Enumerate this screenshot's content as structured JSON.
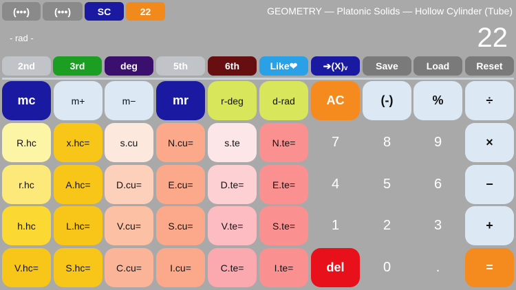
{
  "top_tabs": [
    {
      "label": "(•••)",
      "bg": "#8a8a8a"
    },
    {
      "label": "(•••)",
      "bg": "#8a8a8a"
    },
    {
      "label": "SC",
      "bg": "#1a19a2"
    },
    {
      "label": "22",
      "bg": "#f28a1b"
    }
  ],
  "header": {
    "title": "GEOMETRY — Platonic Solids — Hollow Cylinder (Tube)",
    "angle_mode": "- rad -",
    "display_value": "22"
  },
  "function_row": [
    {
      "label": "2nd",
      "bg": "#c0c3c7",
      "fg": "#ffffff"
    },
    {
      "label": "3rd",
      "bg": "#1b9e22",
      "fg": "#ffffff"
    },
    {
      "label": "deg",
      "bg": "#3a0f6e",
      "fg": "#ffffff"
    },
    {
      "label": "5th",
      "bg": "#c0c3c7",
      "fg": "#ffffff"
    },
    {
      "label": "6th",
      "bg": "#660e10",
      "fg": "#ffffff"
    },
    {
      "label": "Like❤",
      "bg": "#2aa0e6",
      "fg": "#ffffff"
    },
    {
      "label": "➔(X)ᵥ",
      "bg": "#1a19a2",
      "fg": "#ffffff"
    },
    {
      "label": "Save",
      "bg": "#7a7a7a",
      "fg": "#ffffff"
    },
    {
      "label": "Load",
      "bg": "#7a7a7a",
      "fg": "#ffffff"
    },
    {
      "label": "Reset",
      "bg": "#7a7a7a",
      "fg": "#ffffff"
    }
  ],
  "keypad": [
    [
      {
        "label": "mc",
        "bg": "#1a19a2",
        "fg": "#ffffff",
        "style": "big"
      },
      {
        "label": "m+",
        "bg": "#dce9f5",
        "fg": "#111111",
        "style": "mid"
      },
      {
        "label": "m−",
        "bg": "#dce9f5",
        "fg": "#111111",
        "style": "mid"
      },
      {
        "label": "mr",
        "bg": "#1a19a2",
        "fg": "#ffffff",
        "style": "big"
      },
      {
        "label": "r-deg",
        "bg": "#d7e65a",
        "fg": "#111111",
        "style": "mid"
      },
      {
        "label": "d-rad",
        "bg": "#d7e65a",
        "fg": "#111111",
        "style": "mid"
      },
      {
        "label": "AC",
        "bg": "#f58a1f",
        "fg": "#ffffff",
        "style": "big"
      },
      {
        "label": "(-)",
        "bg": "#dce9f5",
        "fg": "#111111",
        "style": "big"
      },
      {
        "label": "%",
        "bg": "#dce9f5",
        "fg": "#111111",
        "style": "big"
      },
      {
        "label": "÷",
        "bg": "#dce9f5",
        "fg": "#111111",
        "style": "big"
      }
    ],
    [
      {
        "label": "R.hc",
        "bg": "#fdf5a6",
        "fg": "#111111",
        "style": "mid"
      },
      {
        "label": "x.hc=",
        "bg": "#f8c618",
        "fg": "#111111",
        "style": "mid"
      },
      {
        "label": "s.cu",
        "bg": "#fde8de",
        "fg": "#111111",
        "style": "mid"
      },
      {
        "label": "N.cu=",
        "bg": "#fba98a",
        "fg": "#111111",
        "style": "mid"
      },
      {
        "label": "s.te",
        "bg": "#fde6e8",
        "fg": "#111111",
        "style": "mid"
      },
      {
        "label": "N.te=",
        "bg": "#fa9090",
        "fg": "#111111",
        "style": "mid"
      },
      {
        "label": "7",
        "bg": "",
        "fg": "#ffffff",
        "style": "digit"
      },
      {
        "label": "8",
        "bg": "",
        "fg": "#ffffff",
        "style": "digit"
      },
      {
        "label": "9",
        "bg": "",
        "fg": "#ffffff",
        "style": "digit"
      },
      {
        "label": "×",
        "bg": "#dce9f5",
        "fg": "#111111",
        "style": "big"
      }
    ],
    [
      {
        "label": "r.hc",
        "bg": "#fde97a",
        "fg": "#111111",
        "style": "mid"
      },
      {
        "label": "A.hc=",
        "bg": "#f8c618",
        "fg": "#111111",
        "style": "mid"
      },
      {
        "label": "D.cu=",
        "bg": "#fdd0bb",
        "fg": "#111111",
        "style": "mid"
      },
      {
        "label": "E.cu=",
        "bg": "#fba98a",
        "fg": "#111111",
        "style": "mid"
      },
      {
        "label": "D.te=",
        "bg": "#fdd0d4",
        "fg": "#111111",
        "style": "mid"
      },
      {
        "label": "E.te=",
        "bg": "#fa9090",
        "fg": "#111111",
        "style": "mid"
      },
      {
        "label": "4",
        "bg": "",
        "fg": "#ffffff",
        "style": "digit"
      },
      {
        "label": "5",
        "bg": "",
        "fg": "#ffffff",
        "style": "digit"
      },
      {
        "label": "6",
        "bg": "",
        "fg": "#ffffff",
        "style": "digit"
      },
      {
        "label": "−",
        "bg": "#dce9f5",
        "fg": "#111111",
        "style": "big"
      }
    ],
    [
      {
        "label": "h.hc",
        "bg": "#fcd833",
        "fg": "#111111",
        "style": "mid"
      },
      {
        "label": "L.hc=",
        "bg": "#f8c618",
        "fg": "#111111",
        "style": "mid"
      },
      {
        "label": "V.cu=",
        "bg": "#fcc0a4",
        "fg": "#111111",
        "style": "mid"
      },
      {
        "label": "S.cu=",
        "bg": "#fba98a",
        "fg": "#111111",
        "style": "mid"
      },
      {
        "label": "V.te=",
        "bg": "#fcbcc2",
        "fg": "#111111",
        "style": "mid"
      },
      {
        "label": "S.te=",
        "bg": "#fa9090",
        "fg": "#111111",
        "style": "mid"
      },
      {
        "label": "1",
        "bg": "",
        "fg": "#ffffff",
        "style": "digit"
      },
      {
        "label": "2",
        "bg": "",
        "fg": "#ffffff",
        "style": "digit"
      },
      {
        "label": "3",
        "bg": "",
        "fg": "#ffffff",
        "style": "digit"
      },
      {
        "label": "+",
        "bg": "#dce9f5",
        "fg": "#111111",
        "style": "big"
      }
    ],
    [
      {
        "label": "V.hc=",
        "bg": "#f8c618",
        "fg": "#111111",
        "style": "mid"
      },
      {
        "label": "S.hc=",
        "bg": "#f8c618",
        "fg": "#111111",
        "style": "mid"
      },
      {
        "label": "C.cu=",
        "bg": "#fbb497",
        "fg": "#111111",
        "style": "mid"
      },
      {
        "label": "I.cu=",
        "bg": "#fba98a",
        "fg": "#111111",
        "style": "mid"
      },
      {
        "label": "C.te=",
        "bg": "#fba8ae",
        "fg": "#111111",
        "style": "mid"
      },
      {
        "label": "I.te=",
        "bg": "#fa9090",
        "fg": "#111111",
        "style": "mid"
      },
      {
        "label": "del",
        "bg": "#e8111b",
        "fg": "#ffffff",
        "style": "big"
      },
      {
        "label": "0",
        "bg": "",
        "fg": "#ffffff",
        "style": "digit"
      },
      {
        "label": ".",
        "bg": "",
        "fg": "#ffffff",
        "style": "digit"
      },
      {
        "label": "=",
        "bg": "#f58a1f",
        "fg": "#ffffff",
        "style": "big"
      }
    ]
  ]
}
